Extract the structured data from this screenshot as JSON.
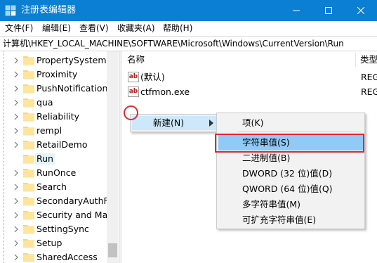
{
  "window": {
    "title": "注册表编辑器",
    "icon": "registry-editor-icon",
    "title_bar_color": "#0a7fd3"
  },
  "menu": [
    {
      "label": "文件(F)"
    },
    {
      "label": "编辑(E)"
    },
    {
      "label": "查看(V)"
    },
    {
      "label": "收藏夹(A)"
    },
    {
      "label": "帮助(H)"
    }
  ],
  "address": "计算机\\HKEY_LOCAL_MACHINE\\SOFTWARE\\Microsoft\\Windows\\CurrentVersion\\Run",
  "tree": {
    "items": [
      {
        "label": "PropertySystem",
        "expandable": true
      },
      {
        "label": "Proximity",
        "expandable": true
      },
      {
        "label": "PushNotifications",
        "expandable": true
      },
      {
        "label": "qua",
        "expandable": true
      },
      {
        "label": "Reliability",
        "expandable": true
      },
      {
        "label": "rempl",
        "expandable": true
      },
      {
        "label": "RetailDemo",
        "expandable": true
      },
      {
        "label": "Run",
        "expandable": false,
        "selected": true
      },
      {
        "label": "RunOnce",
        "expandable": true
      },
      {
        "label": "Search",
        "expandable": true
      },
      {
        "label": "SecondaryAuthFa",
        "expandable": true
      },
      {
        "label": "Security and Main",
        "expandable": true
      },
      {
        "label": "SettingSync",
        "expandable": true
      },
      {
        "label": "Setup",
        "expandable": true
      },
      {
        "label": "SharedAccess",
        "expandable": true
      }
    ]
  },
  "list": {
    "columns": {
      "name": "名称",
      "type": "类型"
    },
    "rows": [
      {
        "icon": "ab",
        "name": "(默认)",
        "type": "REG"
      },
      {
        "icon": "ab",
        "name": "ctfmon.exe",
        "type": "REG"
      }
    ]
  },
  "context_menu": {
    "item": "新建(N)"
  },
  "submenu": {
    "items": [
      {
        "label": "项(K)"
      },
      {
        "label": "字符串值(S)",
        "highlighted": true
      },
      {
        "label": "二进制值(B)"
      },
      {
        "label": "DWORD (32 位)值(D)"
      },
      {
        "label": "QWORD (64 位)值(Q)"
      },
      {
        "label": "多字符串值(M)"
      },
      {
        "label": "可扩充字符串值(E)"
      }
    ]
  },
  "annotations": {
    "highlight_color": "#e0282e"
  }
}
